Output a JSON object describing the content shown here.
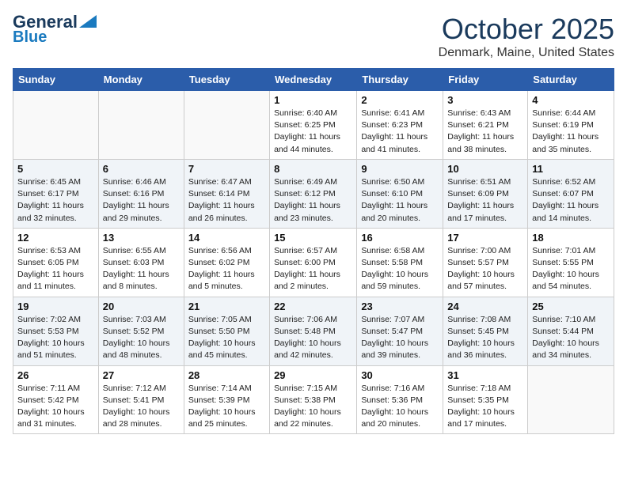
{
  "header": {
    "logo_line1": "General",
    "logo_line2": "Blue",
    "month": "October 2025",
    "location": "Denmark, Maine, United States"
  },
  "weekdays": [
    "Sunday",
    "Monday",
    "Tuesday",
    "Wednesday",
    "Thursday",
    "Friday",
    "Saturday"
  ],
  "weeks": [
    [
      {
        "day": "",
        "info": ""
      },
      {
        "day": "",
        "info": ""
      },
      {
        "day": "",
        "info": ""
      },
      {
        "day": "1",
        "info": "Sunrise: 6:40 AM\nSunset: 6:25 PM\nDaylight: 11 hours\nand 44 minutes."
      },
      {
        "day": "2",
        "info": "Sunrise: 6:41 AM\nSunset: 6:23 PM\nDaylight: 11 hours\nand 41 minutes."
      },
      {
        "day": "3",
        "info": "Sunrise: 6:43 AM\nSunset: 6:21 PM\nDaylight: 11 hours\nand 38 minutes."
      },
      {
        "day": "4",
        "info": "Sunrise: 6:44 AM\nSunset: 6:19 PM\nDaylight: 11 hours\nand 35 minutes."
      }
    ],
    [
      {
        "day": "5",
        "info": "Sunrise: 6:45 AM\nSunset: 6:17 PM\nDaylight: 11 hours\nand 32 minutes."
      },
      {
        "day": "6",
        "info": "Sunrise: 6:46 AM\nSunset: 6:16 PM\nDaylight: 11 hours\nand 29 minutes."
      },
      {
        "day": "7",
        "info": "Sunrise: 6:47 AM\nSunset: 6:14 PM\nDaylight: 11 hours\nand 26 minutes."
      },
      {
        "day": "8",
        "info": "Sunrise: 6:49 AM\nSunset: 6:12 PM\nDaylight: 11 hours\nand 23 minutes."
      },
      {
        "day": "9",
        "info": "Sunrise: 6:50 AM\nSunset: 6:10 PM\nDaylight: 11 hours\nand 20 minutes."
      },
      {
        "day": "10",
        "info": "Sunrise: 6:51 AM\nSunset: 6:09 PM\nDaylight: 11 hours\nand 17 minutes."
      },
      {
        "day": "11",
        "info": "Sunrise: 6:52 AM\nSunset: 6:07 PM\nDaylight: 11 hours\nand 14 minutes."
      }
    ],
    [
      {
        "day": "12",
        "info": "Sunrise: 6:53 AM\nSunset: 6:05 PM\nDaylight: 11 hours\nand 11 minutes."
      },
      {
        "day": "13",
        "info": "Sunrise: 6:55 AM\nSunset: 6:03 PM\nDaylight: 11 hours\nand 8 minutes."
      },
      {
        "day": "14",
        "info": "Sunrise: 6:56 AM\nSunset: 6:02 PM\nDaylight: 11 hours\nand 5 minutes."
      },
      {
        "day": "15",
        "info": "Sunrise: 6:57 AM\nSunset: 6:00 PM\nDaylight: 11 hours\nand 2 minutes."
      },
      {
        "day": "16",
        "info": "Sunrise: 6:58 AM\nSunset: 5:58 PM\nDaylight: 10 hours\nand 59 minutes."
      },
      {
        "day": "17",
        "info": "Sunrise: 7:00 AM\nSunset: 5:57 PM\nDaylight: 10 hours\nand 57 minutes."
      },
      {
        "day": "18",
        "info": "Sunrise: 7:01 AM\nSunset: 5:55 PM\nDaylight: 10 hours\nand 54 minutes."
      }
    ],
    [
      {
        "day": "19",
        "info": "Sunrise: 7:02 AM\nSunset: 5:53 PM\nDaylight: 10 hours\nand 51 minutes."
      },
      {
        "day": "20",
        "info": "Sunrise: 7:03 AM\nSunset: 5:52 PM\nDaylight: 10 hours\nand 48 minutes."
      },
      {
        "day": "21",
        "info": "Sunrise: 7:05 AM\nSunset: 5:50 PM\nDaylight: 10 hours\nand 45 minutes."
      },
      {
        "day": "22",
        "info": "Sunrise: 7:06 AM\nSunset: 5:48 PM\nDaylight: 10 hours\nand 42 minutes."
      },
      {
        "day": "23",
        "info": "Sunrise: 7:07 AM\nSunset: 5:47 PM\nDaylight: 10 hours\nand 39 minutes."
      },
      {
        "day": "24",
        "info": "Sunrise: 7:08 AM\nSunset: 5:45 PM\nDaylight: 10 hours\nand 36 minutes."
      },
      {
        "day": "25",
        "info": "Sunrise: 7:10 AM\nSunset: 5:44 PM\nDaylight: 10 hours\nand 34 minutes."
      }
    ],
    [
      {
        "day": "26",
        "info": "Sunrise: 7:11 AM\nSunset: 5:42 PM\nDaylight: 10 hours\nand 31 minutes."
      },
      {
        "day": "27",
        "info": "Sunrise: 7:12 AM\nSunset: 5:41 PM\nDaylight: 10 hours\nand 28 minutes."
      },
      {
        "day": "28",
        "info": "Sunrise: 7:14 AM\nSunset: 5:39 PM\nDaylight: 10 hours\nand 25 minutes."
      },
      {
        "day": "29",
        "info": "Sunrise: 7:15 AM\nSunset: 5:38 PM\nDaylight: 10 hours\nand 22 minutes."
      },
      {
        "day": "30",
        "info": "Sunrise: 7:16 AM\nSunset: 5:36 PM\nDaylight: 10 hours\nand 20 minutes."
      },
      {
        "day": "31",
        "info": "Sunrise: 7:18 AM\nSunset: 5:35 PM\nDaylight: 10 hours\nand 17 minutes."
      },
      {
        "day": "",
        "info": ""
      }
    ]
  ]
}
